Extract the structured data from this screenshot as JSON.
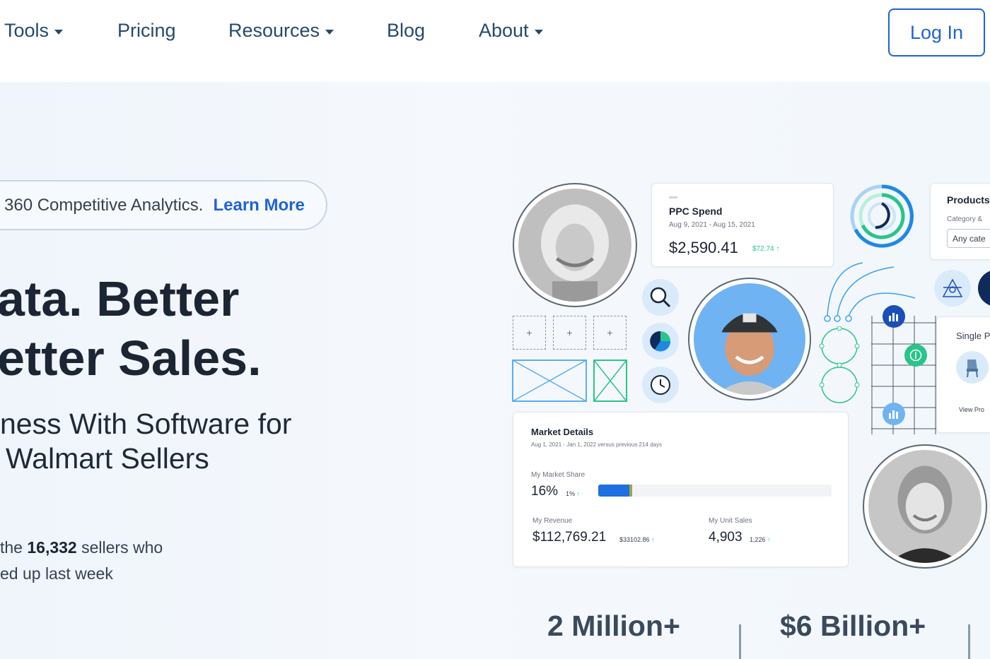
{
  "nav": {
    "items": [
      {
        "label": "Tools",
        "has_dropdown": true
      },
      {
        "label": "Pricing",
        "has_dropdown": false
      },
      {
        "label": "Resources",
        "has_dropdown": true
      },
      {
        "label": "Blog",
        "has_dropdown": false
      },
      {
        "label": "About",
        "has_dropdown": true
      }
    ],
    "login_label": "Log In"
  },
  "hero": {
    "announcement": {
      "text": "360 Competitive Analytics.",
      "link": "Learn More"
    },
    "headline_line1": "ata. Better",
    "headline_line2": "etter Sales.",
    "subhead_line1": "ness With Software for",
    "subhead_line2": "Walmart Sellers",
    "social_prefix": "the",
    "social_count": "16,332",
    "social_suffix": "sellers who",
    "social_line2": "ed up last week"
  },
  "ppc_card": {
    "title": "PPC Spend",
    "date_range": "Aug 9, 2021 - Aug 15, 2021",
    "amount": "$2,590.41",
    "delta": "$72.74"
  },
  "products_card": {
    "title": "Products",
    "filter_label": "Category &",
    "filter_value": "Any cate"
  },
  "single_card": {
    "title": "Single P",
    "button": "View Pro"
  },
  "market_card": {
    "title": "Market Details",
    "date_range": "Aug 1, 2021 - Jan 1, 2022 versus previous 214 days",
    "share_label": "My Market Share",
    "share_value": "16%",
    "share_delta": "1%",
    "share_fraction": 0.16,
    "revenue_label": "My Revenue",
    "revenue_value": "$112,769.21",
    "revenue_delta": "$33102.86",
    "units_label": "My Unit Sales",
    "units_value": "4,903",
    "units_delta": "1,226"
  },
  "wireframe_plus": [
    "+",
    "+",
    "+"
  ],
  "stats": [
    {
      "value": "2 Million+"
    },
    {
      "value": "$6 Billion+"
    }
  ],
  "colors": {
    "brand_blue": "#1f63d6",
    "nav_text": "#244a6c",
    "accent_green": "#2ac48a",
    "light_blue": "#d9eafb"
  }
}
